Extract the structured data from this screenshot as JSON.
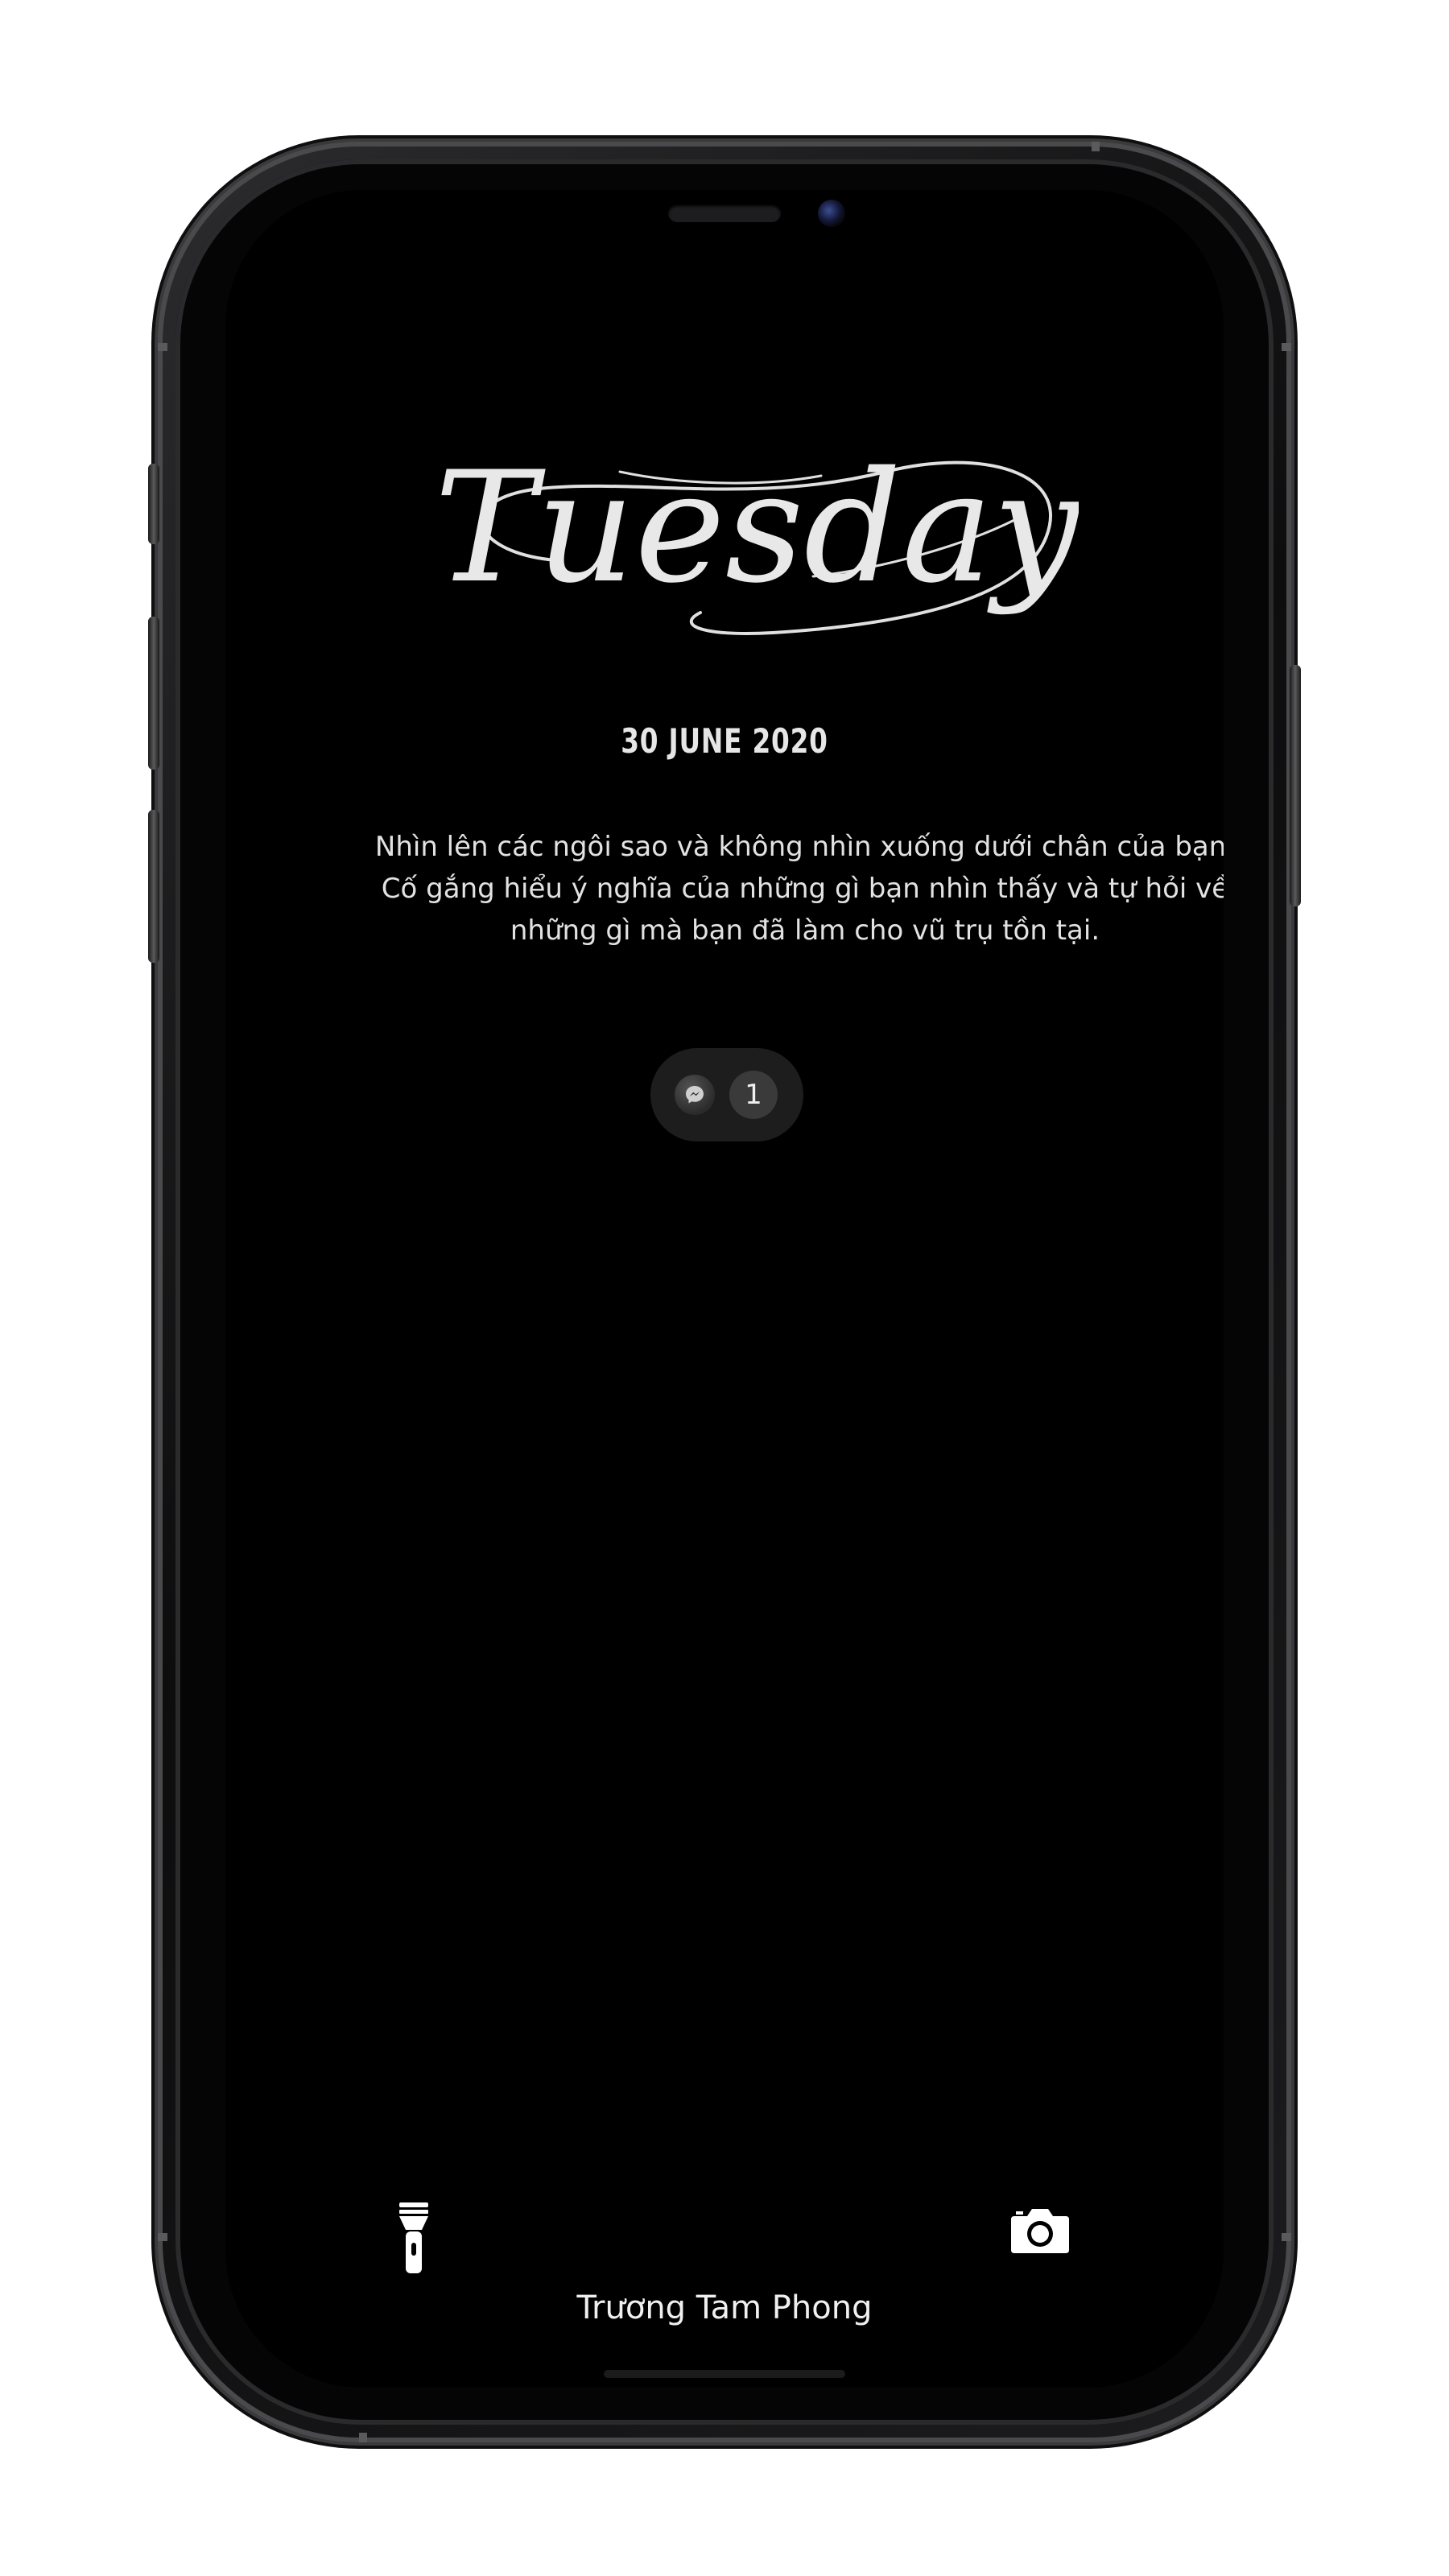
{
  "lockscreen": {
    "day": "Tuesday",
    "date": "30 JUNE 2020",
    "quote": "Nhìn lên các ngôi sao và không nhìn xuống dưới chân của bạn. Cố gắng hiểu ý nghĩa của những gì bạn nhìn thấy và tự hỏi về những gì mà bạn đã làm cho vũ trụ tồn tại.",
    "owner_name": "Trương Tam Phong"
  },
  "notification": {
    "app_icon": "messenger-icon",
    "count": "1"
  },
  "quick_actions": {
    "left_icon": "flashlight-icon",
    "right_icon": "camera-icon"
  },
  "colors": {
    "background": "#000000",
    "text": "#e8e8e8",
    "pill": "#1d1d1d",
    "badge": "#3a3a3a"
  }
}
